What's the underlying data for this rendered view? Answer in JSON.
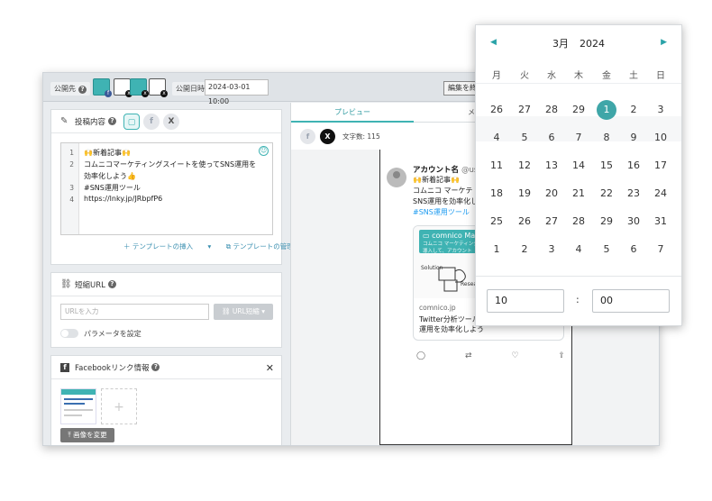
{
  "topbar": {
    "publish_to_label": "公開先",
    "publish_datetime_label": "公開日時",
    "publish_datetime_value": "2024-03-01 10:00",
    "edit_button": "編集を終",
    "accounts": [
      {
        "icon": "comnico-facebook-account-icon",
        "color": "#3fb3b3",
        "badge": "f"
      },
      {
        "icon": "comnico-x-account-icon",
        "color": "#ffffff",
        "badge": "x"
      },
      {
        "icon": "comnico-x-account-icon-2",
        "color": "#3fb3b3",
        "badge": "x"
      },
      {
        "icon": "comnico-x-account-icon-3",
        "color": "#ffffff",
        "badge": "x"
      }
    ]
  },
  "post_panel": {
    "title": "投稿内容",
    "sns": {
      "comnico": "▢",
      "facebook": "f",
      "x": "X"
    },
    "lines": [
      {
        "no": "1",
        "text": "🙌新着記事🙌"
      },
      {
        "no": "2",
        "text": "コムニコマーケティングスイートを使ってSNS運用を"
      },
      {
        "no": "",
        "text": "効率化しよう👍"
      },
      {
        "no": "3",
        "text": "#SNS運用ツール"
      },
      {
        "no": "4",
        "text": "https://lnky.jp/JRbpfP6"
      }
    ],
    "insert_template": "テンプレートの挿入",
    "manage_template": "テンプレートの管理"
  },
  "short_url": {
    "title": "短縮URL",
    "input_placeholder": "URLを入力",
    "button": "URL短縮",
    "param_toggle_label": "パラメータを設定"
  },
  "facebook_link": {
    "title": "Facebookリンク情報",
    "change_image_button": "画像を変更",
    "add_symbol": "+"
  },
  "preview": {
    "tabs": [
      "プレビュー",
      "メモ"
    ],
    "char_count": "文字数: 115",
    "tweet": {
      "name": "アカウント名",
      "handle": "@us",
      "lines": [
        "🙌新着記事🙌",
        "コムニコ マーケテ",
        "SNS運用を効率化し",
        "#SNS運用ツール"
      ],
      "card_banner_title": "comnico Ma",
      "card_banner_sub": "コムニコ マーケティング",
      "card_banner_line2": "導入して、アカウント",
      "card_sketch_words": [
        "Solution",
        "Research"
      ],
      "card_domain": "comnico.jp",
      "card_title_lines": [
        "Twitter分析ツールを導入して、アカウント",
        "運用を効率化しよう"
      ]
    }
  },
  "calendar": {
    "month": "3月",
    "year": "2024",
    "weekdays": [
      "月",
      "火",
      "水",
      "木",
      "金",
      "土",
      "日"
    ],
    "weeks": [
      [
        "26",
        "27",
        "28",
        "29",
        "1",
        "2",
        "3"
      ],
      [
        "4",
        "5",
        "6",
        "7",
        "8",
        "9",
        "10"
      ],
      [
        "11",
        "12",
        "13",
        "14",
        "15",
        "16",
        "17"
      ],
      [
        "18",
        "19",
        "20",
        "21",
        "22",
        "23",
        "24"
      ],
      [
        "25",
        "26",
        "27",
        "28",
        "29",
        "30",
        "31"
      ],
      [
        "1",
        "2",
        "3",
        "4",
        "5",
        "6",
        "7"
      ]
    ],
    "selected_day": "1",
    "hour": "10",
    "minute": "00",
    "colon": ":",
    "accent": "#3fa6a8"
  }
}
